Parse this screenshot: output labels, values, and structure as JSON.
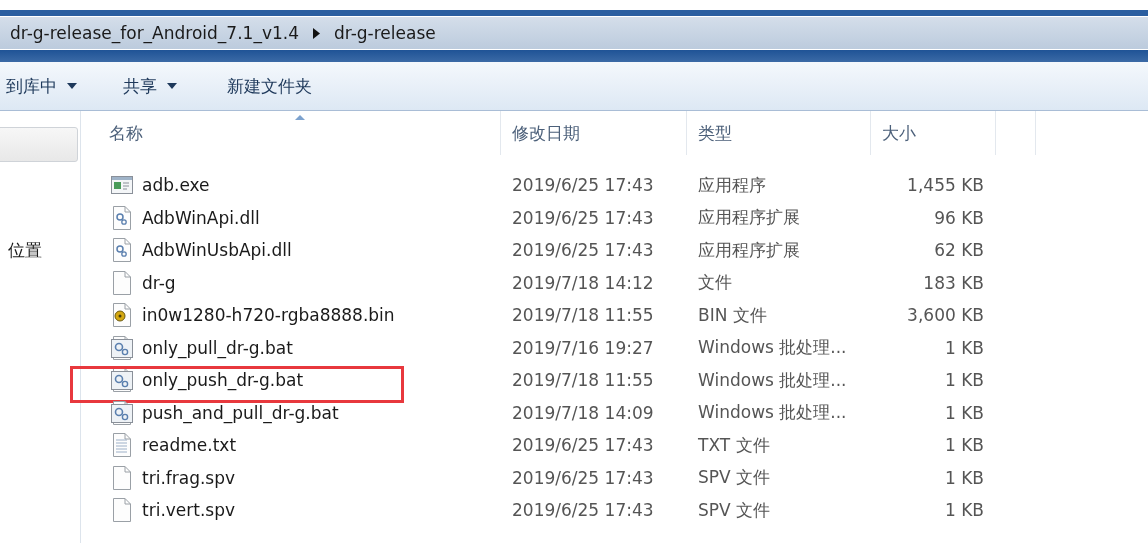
{
  "address_bar": {
    "path": [
      {
        "label": "dr-g-release_for_Android_7.1_v1.4"
      },
      {
        "label": "dr-g-release"
      }
    ]
  },
  "toolbar": [
    {
      "label": "到库中",
      "dropdown": true
    },
    {
      "label": "共享",
      "dropdown": true
    },
    {
      "label": "新建文件夹",
      "dropdown": false
    }
  ],
  "nav_pane": {
    "items": [
      {
        "label": "位置"
      }
    ]
  },
  "table": {
    "columns": [
      {
        "label": "名称",
        "sorted": true
      },
      {
        "label": "修改日期",
        "sorted": false
      },
      {
        "label": "类型",
        "sorted": false
      },
      {
        "label": "大小",
        "sorted": false
      }
    ],
    "rows": [
      {
        "kind": "exe",
        "name": "adb.exe",
        "date": "2019/6/25 17:43",
        "type": "应用程序",
        "size": "1,455 KB",
        "annotated": false
      },
      {
        "kind": "dll",
        "name": "AdbWinApi.dll",
        "date": "2019/6/25 17:43",
        "type": "应用程序扩展",
        "size": "96 KB",
        "annotated": false
      },
      {
        "kind": "dll",
        "name": "AdbWinUsbApi.dll",
        "date": "2019/6/25 17:43",
        "type": "应用程序扩展",
        "size": "62 KB",
        "annotated": false
      },
      {
        "kind": "file",
        "name": "dr-g",
        "date": "2019/7/18 14:12",
        "type": "文件",
        "size": "183 KB",
        "annotated": false
      },
      {
        "kind": "bin",
        "name": "in0w1280-h720-rgba8888.bin",
        "date": "2019/7/18 11:55",
        "type": "BIN 文件",
        "size": "3,600 KB",
        "annotated": false
      },
      {
        "kind": "bat",
        "name": "only_pull_dr-g.bat",
        "date": "2019/7/16 19:27",
        "type": "Windows 批处理...",
        "size": "1 KB",
        "annotated": false
      },
      {
        "kind": "bat",
        "name": "only_push_dr-g.bat",
        "date": "2019/7/18 11:55",
        "type": "Windows 批处理...",
        "size": "1 KB",
        "annotated": true
      },
      {
        "kind": "bat",
        "name": "push_and_pull_dr-g.bat",
        "date": "2019/7/18 14:09",
        "type": "Windows 批处理...",
        "size": "1 KB",
        "annotated": false
      },
      {
        "kind": "txt",
        "name": "readme.txt",
        "date": "2019/6/25 17:43",
        "type": "TXT 文件",
        "size": "1 KB",
        "annotated": false
      },
      {
        "kind": "file",
        "name": "tri.frag.spv",
        "date": "2019/6/25 17:43",
        "type": "SPV 文件",
        "size": "1 KB",
        "annotated": false
      },
      {
        "kind": "file",
        "name": "tri.vert.spv",
        "date": "2019/6/25 17:43",
        "type": "SPV 文件",
        "size": "1 KB",
        "annotated": false
      }
    ]
  }
}
